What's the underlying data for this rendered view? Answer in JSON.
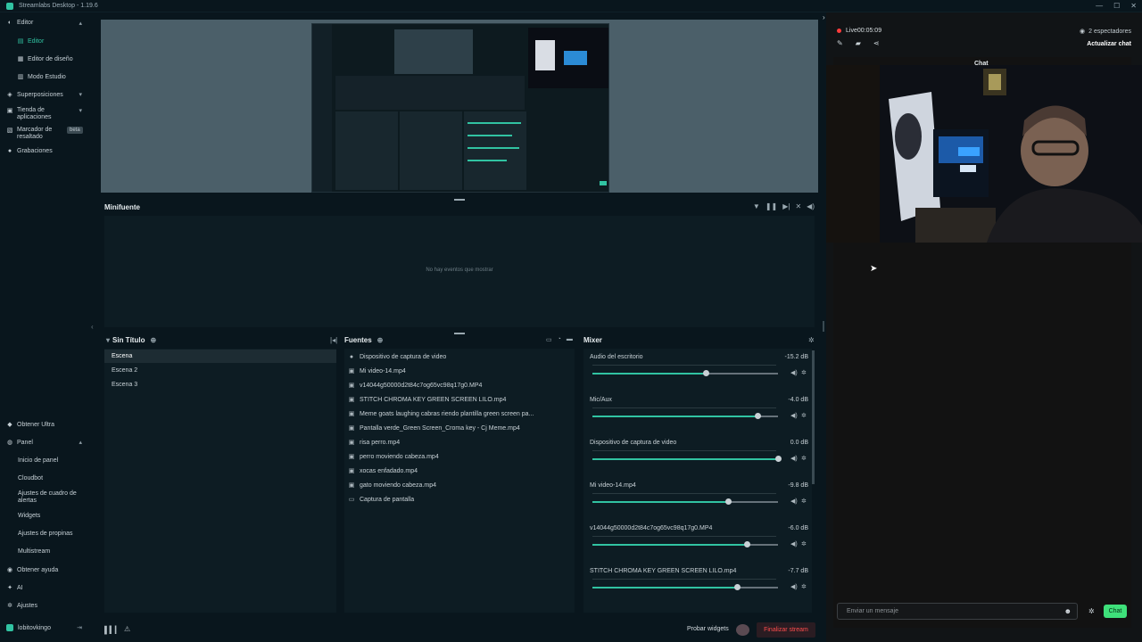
{
  "window": {
    "title": "Streamlabs Desktop - 1.19.6",
    "controls": [
      "—",
      "☐",
      "✕"
    ]
  },
  "sidebar": {
    "editor": "Editor",
    "editor_sub": "Editor",
    "layout_editor": "Editor de diseño",
    "studio_mode": "Modo Estudio",
    "overlays": "Superposiciones",
    "app_store": "Tienda de aplicaciones",
    "highlighter": "Marcador de resaltado",
    "highlighter_badge": "beta",
    "recordings": "Grabaciones",
    "get_ultra": "Obtener Ultra",
    "panel": "Panel",
    "panel_home": "Inicio de panel",
    "cloudbot": "Cloudbot",
    "alert_box": "Ajustes de cuadro de alertas",
    "widgets": "Widgets",
    "tips": "Ajustes de propinas",
    "multistream": "Multistream",
    "help": "Obtener ayuda",
    "ai": "AI",
    "settings": "Ajustes",
    "user": "lobitovkingo"
  },
  "minifeed": {
    "title": "Minifuente",
    "empty": "No hay eventos que mostrar"
  },
  "scenes": {
    "title": "Sin Título",
    "items": [
      "Escena",
      "Escena 2",
      "Escena 3"
    ]
  },
  "sources": {
    "title": "Fuentes",
    "items": [
      {
        "icon": "camera-icon",
        "glyph": "●",
        "label": "Dispositivo de captura de video"
      },
      {
        "icon": "file-icon",
        "glyph": "▣",
        "label": "Mi video-14.mp4"
      },
      {
        "icon": "file-icon",
        "glyph": "▣",
        "label": "v14044g50000d2t84c7og65vc98q17g0.MP4"
      },
      {
        "icon": "file-icon",
        "glyph": "▣",
        "label": "STITCH CHROMA KEY GREEN SCREEN LILO.mp4"
      },
      {
        "icon": "file-icon",
        "glyph": "▣",
        "label": "Meme goats laughing cabras riendo plantilla green screen pa..."
      },
      {
        "icon": "file-icon",
        "glyph": "▣",
        "label": "Pantalla verde_Green Screen_Croma key - Cj Meme.mp4"
      },
      {
        "icon": "file-icon",
        "glyph": "▣",
        "label": "risa perro.mp4"
      },
      {
        "icon": "file-icon",
        "glyph": "▣",
        "label": "perro moviendo cabeza.mp4"
      },
      {
        "icon": "file-icon",
        "glyph": "▣",
        "label": "xocas enfadado.mp4"
      },
      {
        "icon": "file-icon",
        "glyph": "▣",
        "label": "gato moviendo cabeza.mp4"
      },
      {
        "icon": "monitor-icon",
        "glyph": "▭",
        "label": "Captura de pantalla"
      }
    ]
  },
  "mixer": {
    "title": "Mixer",
    "items": [
      {
        "name": "Audio del escritorio",
        "db": "-15.2 dB",
        "level": 0.61
      },
      {
        "name": "Mic/Aux",
        "db": "-4.0 dB",
        "level": 0.89
      },
      {
        "name": "Dispositivo de captura de video",
        "db": "0.0 dB",
        "level": 1.0
      },
      {
        "name": "Mi video-14.mp4",
        "db": "-9.8 dB",
        "level": 0.73
      },
      {
        "name": "v14044g50000d2t84c7og65vc98q17g0.MP4",
        "db": "-6.0 dB",
        "level": 0.83
      },
      {
        "name": "STITCH CHROMA KEY GREEN SCREEN LILO.mp4",
        "db": "-7.7 dB",
        "level": 0.78
      }
    ]
  },
  "bottombar": {
    "test_widgets": "Probar widgets",
    "end_stream": "Finalizar stream"
  },
  "chat": {
    "live_label": "Live",
    "live_time": "00:05:09",
    "viewers": "2 espectadores",
    "refresh": "Actualizar chat",
    "title": "Chat",
    "input_placeholder": "Enviar un mensaje",
    "send_button": "Chat"
  },
  "colors": {
    "accent": "#31c3a2",
    "end_stream": "#ff4d4d",
    "chat_button": "#3ee07a",
    "live_dot": "#ff3c3c"
  }
}
